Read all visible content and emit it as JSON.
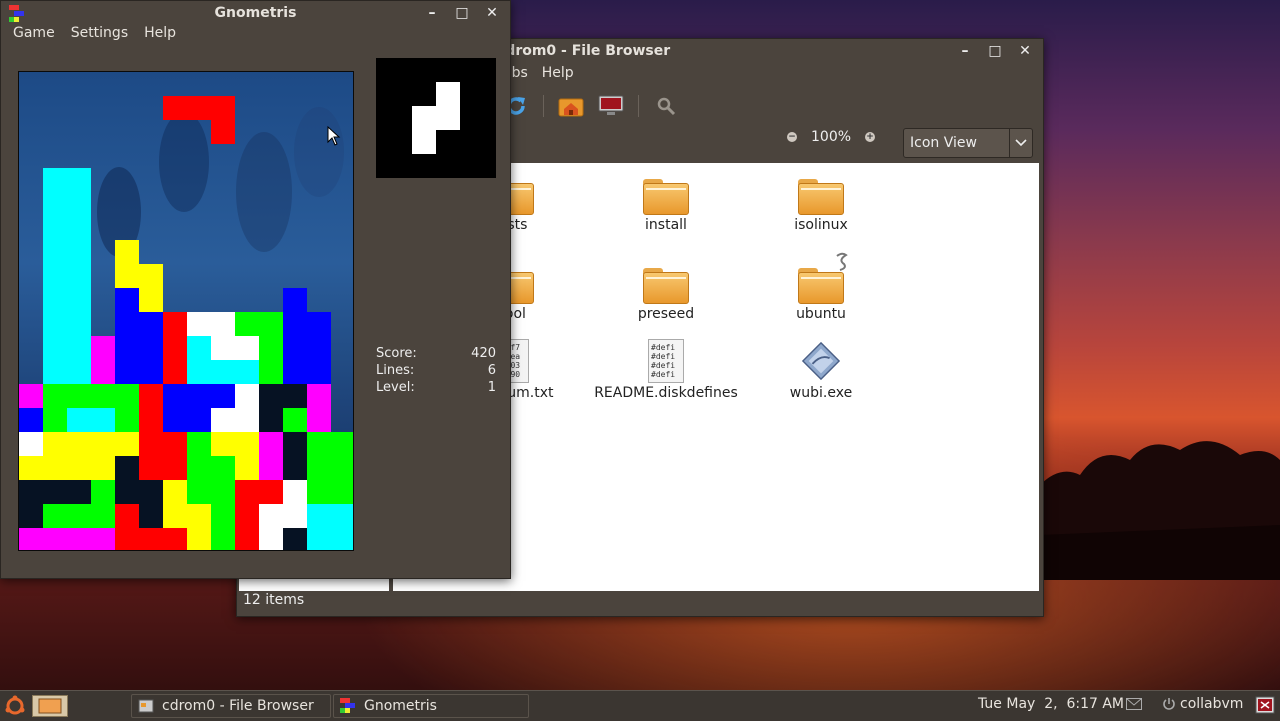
{
  "file_browser": {
    "title": "cdrom0 - File Browser",
    "menu": [
      "abs",
      "Help"
    ],
    "zoom": "100%",
    "view_mode": "Icon View",
    "status": "12 items",
    "files": [
      {
        "name": "dists",
        "kind": "folder"
      },
      {
        "name": "install",
        "kind": "folder"
      },
      {
        "name": "isolinux",
        "kind": "folder"
      },
      {
        "name": "pool",
        "kind": "folder"
      },
      {
        "name": "preseed",
        "kind": "folder"
      },
      {
        "name": "ubuntu",
        "kind": "folder"
      },
      {
        "name": "md5sum.txt",
        "kind": "text",
        "preview": [
          "e09f7",
          "811ea",
          "acd03",
          "8ee90"
        ]
      },
      {
        "name": "README.diskdefines",
        "kind": "text",
        "preview": [
          "#defi",
          "#defi",
          "#defi",
          "#defi"
        ]
      },
      {
        "name": "wubi.exe",
        "kind": "exe"
      }
    ]
  },
  "gnometris": {
    "title": "Gnometris",
    "menu": [
      "Game",
      "Settings",
      "Help"
    ],
    "score_label": "Score:",
    "score": "420",
    "lines_label": "Lines:",
    "lines": "6",
    "level_label": "Level:",
    "level": "1",
    "board": {
      "cols": 14,
      "rows": 20,
      "falling_piece": {
        "color": "#ff0000",
        "cells": [
          [
            6,
            1
          ],
          [
            7,
            1
          ],
          [
            8,
            1
          ],
          [
            8,
            2
          ]
        ]
      },
      "next_piece": {
        "color": "#ffffff",
        "cells": [
          [
            1,
            0
          ],
          [
            0,
            1
          ],
          [
            1,
            1
          ],
          [
            0,
            2
          ]
        ]
      },
      "grid": [
        "..............",
        "..............",
        "..............",
        "..............",
        ".CC...........",
        ".CC...........",
        ".CC...........",
        ".CC.Y.........",
        ".CC.YY........",
        ".CC.BY.....B..",
        ".CC.BBRWWGGBB.",
        ".CCMBBRCWWGBB.",
        ".CCMBBRCCCGBB.",
        "MGGGGRBBBWKKM",
        "BGCCGRBBWWKGM",
        "WYYYYRRGYYMKGG",
        "YYYYKRRGGYMKGG",
        "KKKGKKYGGRRWGG",
        "KGGGRKYYGRWWCC",
        "MMMMRRRYGRWKCC"
      ],
      "palette": {
        "C": "#00ffff",
        "Y": "#ffff00",
        "B": "#0000ff",
        "R": "#ff0000",
        "W": "#ffffff",
        "G": "#00ff00",
        "M": "#ff00ff",
        "K": "#061223"
      }
    }
  },
  "taskbar": {
    "tasks": [
      "cdrom0 - File Browser",
      "Gnometris"
    ],
    "clock": "Tue May  2,  6:17 AM",
    "user": "collabvm"
  },
  "colors": {
    "accent": "#e8982c",
    "window_bg": "#4b443d"
  }
}
